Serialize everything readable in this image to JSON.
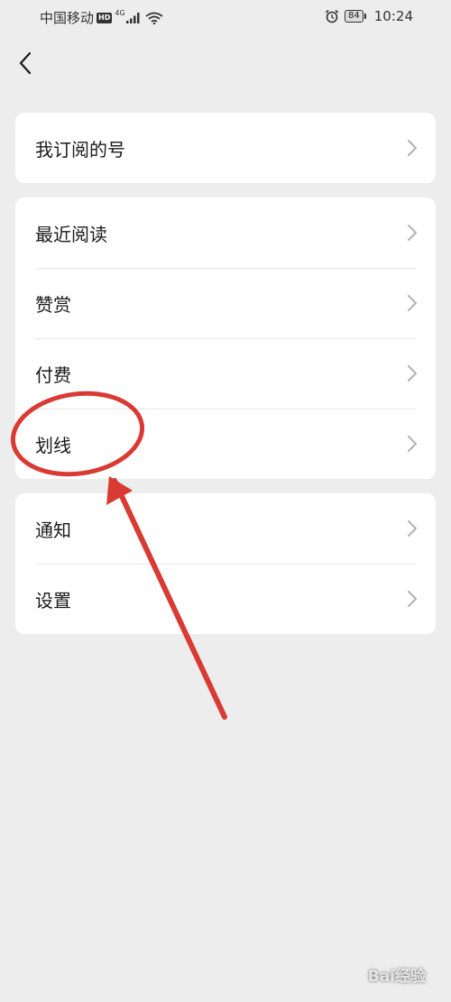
{
  "status_bar": {
    "carrier": "中国移动",
    "hd": "HD",
    "network": "4G",
    "battery": "84",
    "time": "10:24"
  },
  "sections": [
    {
      "items": [
        {
          "label": "我订阅的号"
        }
      ]
    },
    {
      "items": [
        {
          "label": "最近阅读"
        },
        {
          "label": "赞赏"
        },
        {
          "label": "付费"
        },
        {
          "label": "划线"
        }
      ]
    },
    {
      "items": [
        {
          "label": "通知"
        },
        {
          "label": "设置"
        }
      ]
    }
  ],
  "colors": {
    "background": "#ededed",
    "card": "#ffffff",
    "annotation": "#d93a33"
  },
  "annotation": {
    "highlighted_item": "划线"
  },
  "watermark": "Bai经验"
}
